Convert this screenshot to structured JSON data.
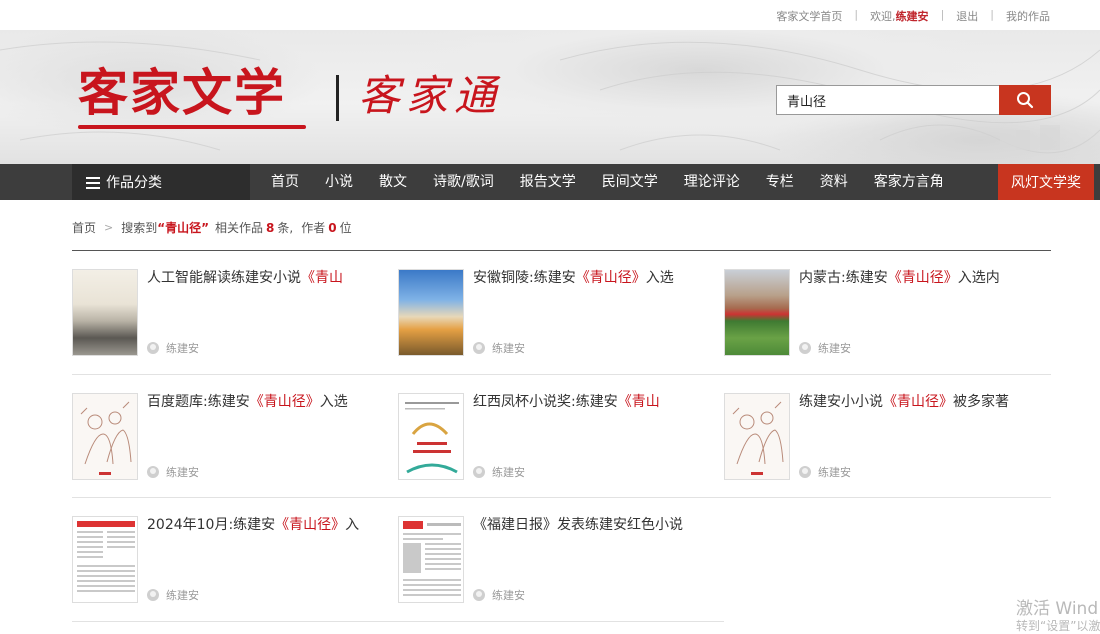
{
  "topbar": {
    "home_link": "客家文学首页",
    "welcome": "欢迎,",
    "username": "练建安",
    "logout": "退出",
    "my_works": "我的作品"
  },
  "header": {
    "logo_main": "客家文学",
    "logo_script": "客家通",
    "search_value": "青山径",
    "search_icon": "search-icon"
  },
  "nav": {
    "category_label": "作品分类",
    "items": [
      "首页",
      "小说",
      "散文",
      "诗歌/歌词",
      "报告文学",
      "民间文学",
      "理论评论",
      "专栏",
      "资料",
      "客家方言角"
    ],
    "award": "风灯文学奖"
  },
  "breadcrumb": {
    "home": "首页",
    "prefix": "搜索到",
    "keyword": "“青山径”",
    "works_text": "相关作品",
    "works_count": "8",
    "works_unit": "条,",
    "author_text": "作者",
    "author_count": "0",
    "author_unit": "位"
  },
  "works": [
    {
      "title_pre": "人工智能解读练建安小说",
      "title_hl": "《青山",
      "title_post": "",
      "author": "练建安",
      "thumb": "ink-painting"
    },
    {
      "title_pre": "安徽铜陵:练建安",
      "title_hl": "《青山径》",
      "title_post": "入选",
      "author": "练建安",
      "thumb": "sky-photo"
    },
    {
      "title_pre": "内蒙古:练建安",
      "title_hl": "《青山径》",
      "title_post": "入选内",
      "author": "练建安",
      "thumb": "field-photo"
    },
    {
      "title_pre": "百度题库:练建安",
      "title_hl": "《青山径》",
      "title_post": "入选",
      "author": "练建安",
      "thumb": "sketch"
    },
    {
      "title_pre": "红西凤杯小说奖:练建安",
      "title_hl": "《青山",
      "title_post": "",
      "author": "练建安",
      "thumb": "poster"
    },
    {
      "title_pre": "练建安小小说",
      "title_hl": "《青山径》",
      "title_post": "被多家著",
      "author": "练建安",
      "thumb": "sketch"
    },
    {
      "title_pre": "2024年10月:练建安",
      "title_hl": "《青山径》",
      "title_post": "入",
      "author": "练建安",
      "thumb": "newspaper"
    },
    {
      "title_pre": "《福建日报》发表练建安红色小说",
      "title_hl": "",
      "title_post": "",
      "author": "练建安",
      "thumb": "newspaper"
    }
  ],
  "watermark": {
    "line1": "激活 Wind",
    "line2": "转到“设置”以激"
  }
}
